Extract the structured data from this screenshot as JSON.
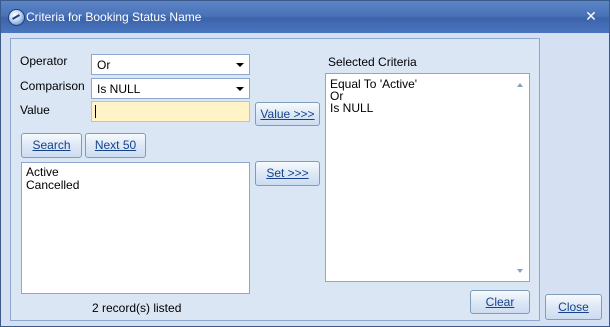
{
  "window": {
    "title": "Criteria for Booking Status Name",
    "icon": "app-icon",
    "close_glyph": "✕"
  },
  "form": {
    "operator_label": "Operator",
    "operator_value": "Or",
    "comparison_label": "Comparison",
    "comparison_value": "Is NULL",
    "value_label": "Value",
    "value_text": ""
  },
  "buttons": {
    "value_btn": "Value >>>",
    "search_btn": "Search",
    "next_btn": "Next 50",
    "set_btn": "Set >>>",
    "clear_btn": "Clear",
    "close_btn": "Close"
  },
  "results": {
    "items": [
      "Active",
      "Cancelled"
    ],
    "status": "2 record(s) listed"
  },
  "criteria": {
    "heading": "Selected Criteria",
    "lines": [
      "Equal To 'Active'",
      "Or",
      "Is NULL"
    ]
  },
  "colors": {
    "titlebar": "#4a72b8",
    "window_bg": "#d5e1f2",
    "value_field_bg": "#fff3c7"
  }
}
